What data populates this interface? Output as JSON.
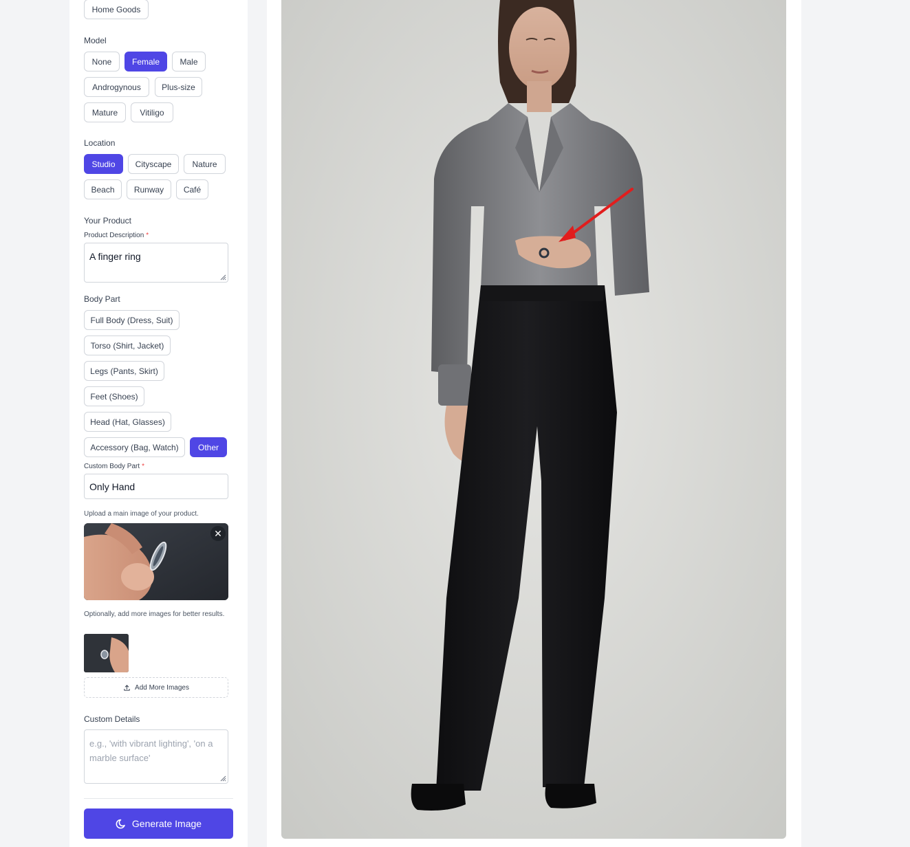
{
  "category": {
    "selected_label": "Home Goods"
  },
  "model": {
    "title": "Model",
    "options": [
      "None",
      "Female",
      "Male",
      "Androgynous",
      "Plus-size",
      "Mature",
      "Vitiligo"
    ],
    "selected": "Female"
  },
  "location": {
    "title": "Location",
    "options": [
      "Studio",
      "Cityscape",
      "Nature",
      "Beach",
      "Runway",
      "Café"
    ],
    "selected": "Studio"
  },
  "product": {
    "title": "Your Product",
    "description_label": "Product Description",
    "description_required": "*",
    "description_value": "A finger ring"
  },
  "body_part": {
    "title": "Body Part",
    "options": [
      "Full Body (Dress, Suit)",
      "Torso (Shirt, Jacket)",
      "Legs (Pants, Skirt)",
      "Feet (Shoes)",
      "Head (Hat, Glasses)",
      "Accessory (Bag, Watch)",
      "Other"
    ],
    "selected": "Other",
    "custom_label": "Custom Body Part",
    "custom_required": "*",
    "custom_value": "Only Hand"
  },
  "upload": {
    "main_hint": "Upload a main image of your product.",
    "extra_hint": "Optionally, add more images for better results.",
    "add_more_label": "Add More Images",
    "close_glyph": "✕"
  },
  "custom_details": {
    "title": "Custom Details",
    "placeholder": "e.g., 'with vibrant lighting', 'on a marble surface'"
  },
  "generate": {
    "label": "Generate Image"
  },
  "colors": {
    "accent": "#4f46e5",
    "required": "#ef4444",
    "annotation_arrow": "#e11d1d"
  }
}
